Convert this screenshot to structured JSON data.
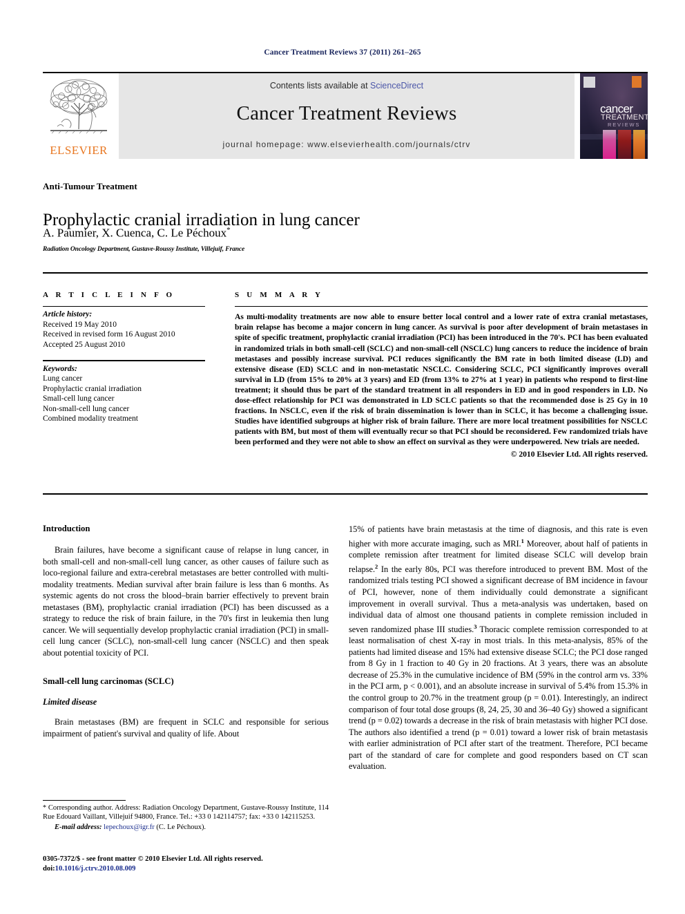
{
  "running_head": "Cancer Treatment Reviews 37 (2011) 261–265",
  "masthead": {
    "publisher_name": "ELSEVIER",
    "contents_prefix": "Contents lists available at ",
    "contents_link": "ScienceDirect",
    "journal_title": "Cancer Treatment Reviews",
    "homepage": "journal homepage: www.elsevierhealth.com/journals/ctrv",
    "cover": {
      "word1": "cancer",
      "word2": "TREATMENT",
      "word3": "REVIEWS"
    }
  },
  "article": {
    "section_label": "Anti-Tumour Treatment",
    "title": "Prophylactic cranial irradiation in lung cancer",
    "authors": "A. Paumier, X. Cuenca, C. Le Péchoux",
    "author_marker": "*",
    "affiliation": "Radiation Oncology Department, Gustave-Roussy Institute, Villejuif, France"
  },
  "info_panel": {
    "header": "A R T I C L E   I N F O",
    "history_label": "Article history:",
    "history": [
      "Received 19 May 2010",
      "Received in revised form 16 August 2010",
      "Accepted 25 August 2010"
    ],
    "keywords_label": "Keywords:",
    "keywords": [
      "Lung cancer",
      "Prophylactic cranial irradiation",
      "Small-cell lung cancer",
      "Non-small-cell lung cancer",
      "Combined modality treatment"
    ]
  },
  "summary_panel": {
    "header": "S U M M A R Y",
    "text": "As multi-modality treatments are now able to ensure better local control and a lower rate of extra cranial metastases, brain relapse has become a major concern in lung cancer. As survival is poor after development of brain metastases in spite of specific treatment, prophylactic cranial irradiation (PCI) has been introduced in the 70's. PCI has been evaluated in randomized trials in both small-cell (SCLC) and non-small-cell (NSCLC) lung cancers to reduce the incidence of brain metastases and possibly increase survival. PCI reduces significantly the BM rate in both limited disease (LD) and extensive disease (ED) SCLC and in non-metastatic NSCLC. Considering SCLC, PCI significantly improves overall survival in LD (from 15% to 20% at 3 years) and ED (from 13% to 27% at 1 year) in patients who respond to first-line treatment; it should thus be part of the standard treatment in all responders in ED and in good responders in LD. No dose-effect relationship for PCI was demonstrated in LD SCLC patients so that the recommended dose is 25 Gy in 10 fractions. In NSCLC, even if the risk of brain dissemination is lower than in SCLC, it has become a challenging issue. Studies have identified subgroups at higher risk of brain failure. There are more local treatment possibilities for NSCLC patients with BM, but most of them will eventually recur so that PCI should be reconsidered. Few randomized trials have been performed and they were not able to show an effect on survival as they were underpowered. New trials are needed.",
    "copyright": "© 2010 Elsevier Ltd. All rights reserved."
  },
  "body": {
    "left": {
      "intro_heading": "Introduction",
      "intro_para": "Brain failures, have become a significant cause of relapse in lung cancer, in both small-cell and non-small-cell lung cancer, as other causes of failure such as loco-regional failure and extra-cerebral metastases are better controlled with multi-modality treatments. Median survival after brain failure is less than 6 months. As systemic agents do not cross the blood–brain barrier effectively to prevent brain metastases (BM), prophylactic cranial irradiation (PCI) has been discussed as a strategy to reduce the risk of brain failure, in the 70's first in leukemia then lung cancer. We will sequentially develop prophylactic cranial irradiation (PCI) in small-cell lung cancer (SCLC), non-small-cell lung cancer (NSCLC) and then speak about potential toxicity of PCI.",
      "sclc_heading": "Small-cell lung carcinomas (SCLC)",
      "limited_disease_heading": "Limited disease",
      "limited_disease_para": "Brain metastases (BM) are frequent in SCLC and responsible for serious impairment of patient's survival and quality of life. About"
    },
    "right": {
      "para1_a": "15% of patients have brain metastasis at the time of diagnosis, and this rate is even higher with more accurate imaging, such as MRI.",
      "para1_ref1": "1",
      "para1_b": " Moreover, about half of patients in complete remission after treatment for limited disease SCLC will develop brain relapse.",
      "para1_ref2": "2",
      "para1_c": " In the early 80s, PCI was therefore introduced to prevent BM. Most of the randomized trials testing PCI showed a significant decrease of BM incidence in favour of PCI, however, none of them individually could demonstrate a significant improvement in overall survival. Thus a meta-analysis was undertaken, based on individual data of almost one thousand patients in complete remission included in seven randomized phase III studies.",
      "para1_ref3": "3",
      "para1_d": " Thoracic complete remission corresponded to at least normalisation of chest X-ray in most trials. In this meta-analysis, 85% of the patients had limited disease and 15% had extensive disease SCLC; the PCI dose ranged from 8 Gy in 1 fraction to 40 Gy in 20 fractions. At 3 years, there was an absolute decrease of 25.3% in the cumulative incidence of BM (59% in the control arm vs. 33% in the PCI arm, p < 0.001), and an absolute increase in survival of 5.4% from 15.3% in the control group to 20.7% in the treatment group (p = 0.01). Interestingly, an indirect comparison of four total dose groups (8, 24, 25, 30 and 36–40 Gy) showed a significant trend (p = 0.02) towards a decrease in the risk of brain metastasis with higher PCI dose. The authors also identified a trend (p = 0.01) toward a lower risk of brain metastasis with earlier administration of PCI after start of the treatment. Therefore, PCI became part of the standard of care for complete and good responders based on CT scan evaluation."
    }
  },
  "footnote": {
    "marker": "*",
    "text": " Corresponding author. Address: Radiation Oncology Department, Gustave-Roussy Institute, 114 Rue Edouard Vaillant, Villejuif 94800, France. Tel.: +33 0 142114757; fax: +33 0 142115253.",
    "email_label": "E-mail address:",
    "email": "lepechoux@igr.fr",
    "email_owner": "(C. Le Péchoux)."
  },
  "issn": {
    "line1": "0305-7372/$ - see front matter © 2010 Elsevier Ltd. All rights reserved.",
    "doi_label": "doi:",
    "doi_value": "10.1016/j.ctrv.2010.08.009"
  },
  "colors": {
    "running_head": "#18245c",
    "link": "#1a2d8d",
    "sciencedirect": "#4b56a8",
    "elsevier_orange": "#e87722",
    "grey_box": "#e6e6e6"
  }
}
